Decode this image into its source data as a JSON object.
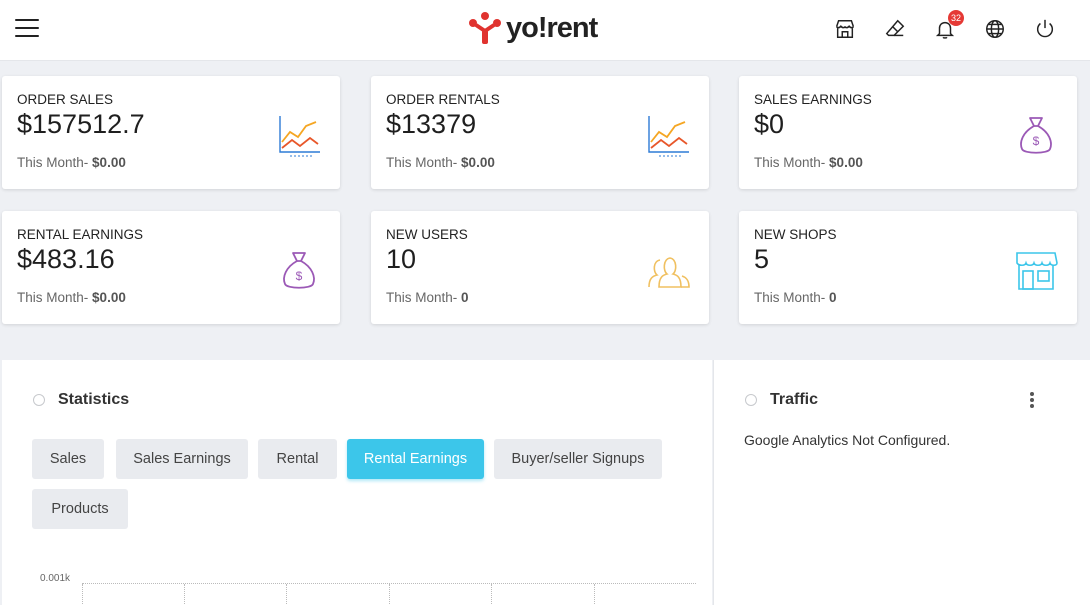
{
  "header": {
    "logo_text": "yo!rent",
    "notification_count": "32",
    "icons": [
      "store-icon",
      "eraser-icon",
      "bell-icon",
      "globe-icon",
      "power-icon"
    ]
  },
  "cards": [
    {
      "title": "ORDER SALES",
      "value": "$157512.7",
      "sub_label": "This Month-",
      "sub_value": "$0.00",
      "icon": "line-chart-icon"
    },
    {
      "title": "ORDER RENTALS",
      "value": "$13379",
      "sub_label": "This Month-",
      "sub_value": "$0.00",
      "icon": "line-chart-icon"
    },
    {
      "title": "SALES EARNINGS",
      "value": "$0",
      "sub_label": "This Month-",
      "sub_value": "$0.00",
      "icon": "money-bag-icon"
    },
    {
      "title": "RENTAL EARNINGS",
      "value": "$483.16",
      "sub_label": "This Month-",
      "sub_value": "$0.00",
      "icon": "money-bag-icon"
    },
    {
      "title": "NEW USERS",
      "value": "10",
      "sub_label": "This Month-",
      "sub_value": "0",
      "icon": "users-icon"
    },
    {
      "title": "NEW SHOPS",
      "value": "5",
      "sub_label": "This Month-",
      "sub_value": "0",
      "icon": "shop-icon"
    }
  ],
  "statistics": {
    "title": "Statistics",
    "tabs": [
      {
        "label": "Sales",
        "active": false
      },
      {
        "label": "Sales Earnings",
        "active": false
      },
      {
        "label": "Rental",
        "active": false
      },
      {
        "label": "Rental Earnings",
        "active": true
      },
      {
        "label": "Buyer/seller Signups",
        "active": false
      },
      {
        "label": "Products",
        "active": false
      }
    ],
    "y_axis_label": "0.001k"
  },
  "traffic": {
    "title": "Traffic",
    "message": "Google Analytics Not Configured."
  },
  "colors": {
    "accent": "#3cc6ea",
    "badge": "#e53935",
    "chart_orange": "#f5a623",
    "chart_red": "#e8572a",
    "chart_blue": "#2d7bd6",
    "bag_purple": "#9b59b6",
    "users_gold": "#f0c060",
    "shop_cyan": "#3cc6ea"
  }
}
